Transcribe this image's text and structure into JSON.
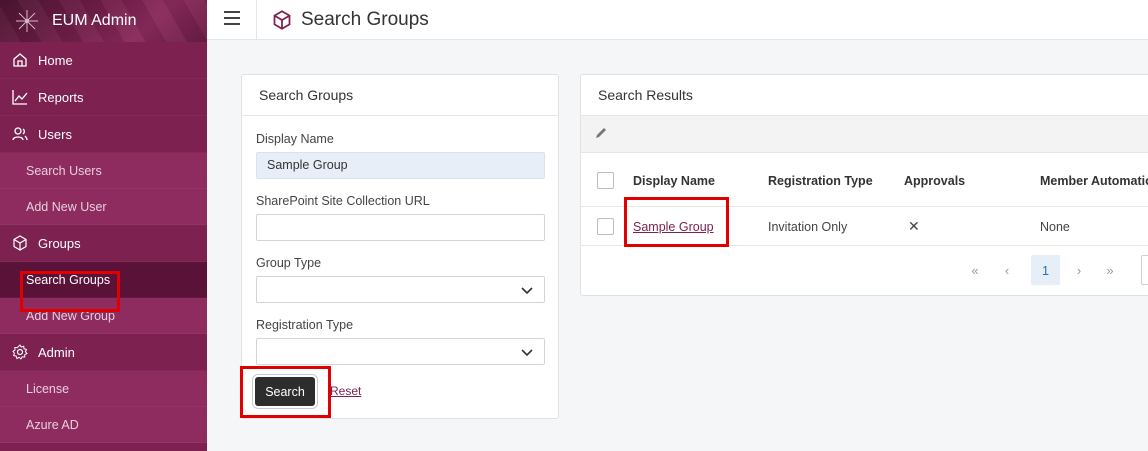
{
  "app": {
    "name": "EUM Admin"
  },
  "header": {
    "title": "Search Groups"
  },
  "sidebar": {
    "items": [
      {
        "label": "Home",
        "type": "section",
        "icon": "home-icon"
      },
      {
        "label": "Reports",
        "type": "section",
        "icon": "chart-icon"
      },
      {
        "label": "Users",
        "type": "section",
        "icon": "users-icon"
      },
      {
        "label": "Search Users",
        "type": "sub"
      },
      {
        "label": "Add New User",
        "type": "sub"
      },
      {
        "label": "Groups",
        "type": "section",
        "icon": "cube-icon"
      },
      {
        "label": "Search Groups",
        "type": "sub",
        "active": true
      },
      {
        "label": "Add New Group",
        "type": "sub"
      },
      {
        "label": "Admin",
        "type": "section",
        "icon": "gear-icon"
      },
      {
        "label": "License",
        "type": "sub"
      },
      {
        "label": "Azure AD",
        "type": "sub"
      }
    ]
  },
  "form": {
    "title": "Search Groups",
    "display_name_label": "Display Name",
    "display_name_value": "Sample Group",
    "site_url_label": "SharePoint Site Collection URL",
    "site_url_value": "",
    "group_type_label": "Group Type",
    "group_type_value": "",
    "registration_type_label": "Registration Type",
    "registration_type_value": "",
    "search_label": "Search",
    "reset_label": "Reset"
  },
  "results": {
    "title": "Search Results",
    "columns": [
      "Display Name",
      "Registration Type",
      "Approvals",
      "Member Automatio"
    ],
    "rows": [
      {
        "display_name": "Sample Group",
        "registration_type": "Invitation Only",
        "approvals": "✕",
        "member_automation": "None"
      }
    ],
    "pager": {
      "first": "«",
      "prev": "‹",
      "page": "1",
      "next": "›",
      "last": "»"
    }
  },
  "colors": {
    "sidebar": "#7d2151",
    "active": "#5a1238",
    "highlight": "#e00000",
    "accent": "#7d2151"
  }
}
